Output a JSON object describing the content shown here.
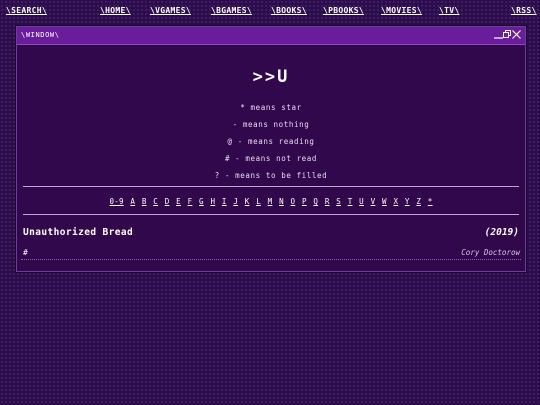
{
  "nav": {
    "search": "\\SEARCH\\",
    "home": "\\HOME\\",
    "vgames": "\\VGAMES\\",
    "bgames": "\\BGAMES\\",
    "books": "\\BOOKS\\",
    "pbooks": "\\PBOOKS\\",
    "movies": "\\MOVIES\\",
    "tv": "\\TV\\",
    "rss": "\\RSS\\"
  },
  "window": {
    "title": "\\WINDOW\\",
    "heading": ">>U",
    "legend": [
      "* means star",
      "- means nothing",
      "@ - means reading",
      "# - means not read",
      "? - means to be filled"
    ],
    "alphabet": [
      "0-9",
      "A",
      "B",
      "C",
      "D",
      "E",
      "F",
      "G",
      "H",
      "I",
      "J",
      "K",
      "L",
      "M",
      "N",
      "O",
      "P",
      "Q",
      "R",
      "S",
      "T",
      "U",
      "V",
      "W",
      "X",
      "Y",
      "Z",
      "*"
    ],
    "entry": {
      "title": "Unauthorized Bread",
      "year": "(2019)",
      "status": "#",
      "author": "Cory Doctorow"
    }
  },
  "colors": {
    "background": "#2a0d4a",
    "window_bg": "#32084c",
    "titlebar": "#6a1d9a",
    "text": "#ffffff"
  }
}
